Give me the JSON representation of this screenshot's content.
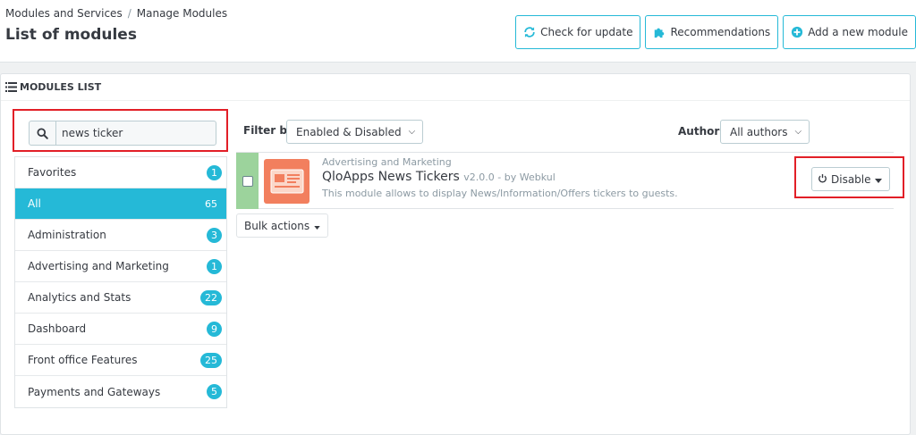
{
  "header": {
    "breadcrumb": [
      "Modules and Services",
      "Manage Modules"
    ],
    "breadcrumb_sep": "/",
    "title": "List of modules",
    "toolbar": {
      "check_update": "Check for update",
      "recommendations": "Recommendations",
      "add_module": "Add a new module"
    }
  },
  "panel": {
    "heading": "MODULES LIST",
    "search": {
      "value": "news ticker"
    },
    "categories": [
      {
        "label": "Favorites",
        "count": "1",
        "active": false
      },
      {
        "label": "All",
        "count": "65",
        "active": true
      },
      {
        "label": "Administration",
        "count": "3",
        "active": false
      },
      {
        "label": "Advertising and Marketing",
        "count": "1",
        "active": false
      },
      {
        "label": "Analytics and Stats",
        "count": "22",
        "active": false
      },
      {
        "label": "Dashboard",
        "count": "9",
        "active": false
      },
      {
        "label": "Front office Features",
        "count": "25",
        "active": false
      },
      {
        "label": "Payments and Gateways",
        "count": "5",
        "active": false
      }
    ],
    "filter": {
      "label": "Filter by",
      "status_value": "Enabled & Disabled",
      "authors_label": "Authors",
      "authors_value": "All authors"
    },
    "module": {
      "category": "Advertising and Marketing",
      "name": "QloApps News Tickers",
      "version": "v2.0.0 - by Webkul",
      "description": "This module allows to display News/Information/Offers tickers to guests.",
      "action": "Disable"
    },
    "bulk_actions": "Bulk actions"
  },
  "colors": {
    "accent": "#25b9d7",
    "highlight_box": "#e21f27",
    "enabled_status": "#9cd39c",
    "module_logo": "#f27f5e"
  }
}
